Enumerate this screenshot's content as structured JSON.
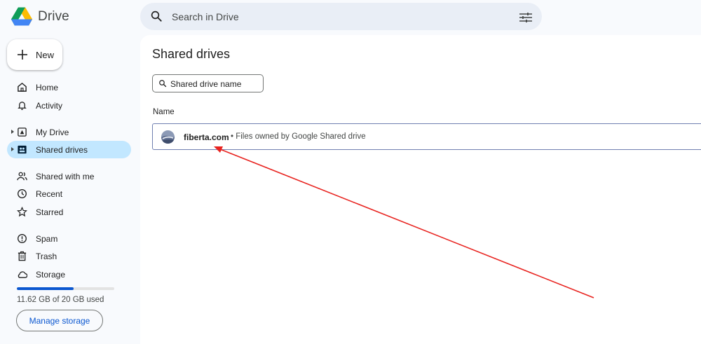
{
  "app": {
    "name": "Drive"
  },
  "search": {
    "placeholder": "Search in Drive"
  },
  "sidebar": {
    "new_label": "New",
    "items": [
      {
        "label": "Home",
        "icon": "home-icon"
      },
      {
        "label": "Activity",
        "icon": "bell-icon"
      },
      {
        "label": "My Drive",
        "icon": "my-drive-icon"
      },
      {
        "label": "Shared drives",
        "icon": "shared-drives-icon"
      },
      {
        "label": "Shared with me",
        "icon": "people-icon"
      },
      {
        "label": "Recent",
        "icon": "clock-icon"
      },
      {
        "label": "Starred",
        "icon": "star-icon"
      },
      {
        "label": "Spam",
        "icon": "spam-icon"
      },
      {
        "label": "Trash",
        "icon": "trash-icon"
      },
      {
        "label": "Storage",
        "icon": "cloud-icon"
      }
    ],
    "storage": {
      "used_text": "11.62 GB of 20 GB used",
      "used_fraction": 0.581,
      "manage_label": "Manage storage"
    }
  },
  "main": {
    "title": "Shared drives",
    "filter_placeholder": "Shared drive name",
    "column_header": "Name",
    "drives": [
      {
        "name": "fiberta.com",
        "meta": "• Files owned by Google Shared drive"
      }
    ]
  },
  "colors": {
    "accent": "#0b57d0",
    "active_nav": "#c2e7ff",
    "annotation_arrow": "#e8231f"
  }
}
